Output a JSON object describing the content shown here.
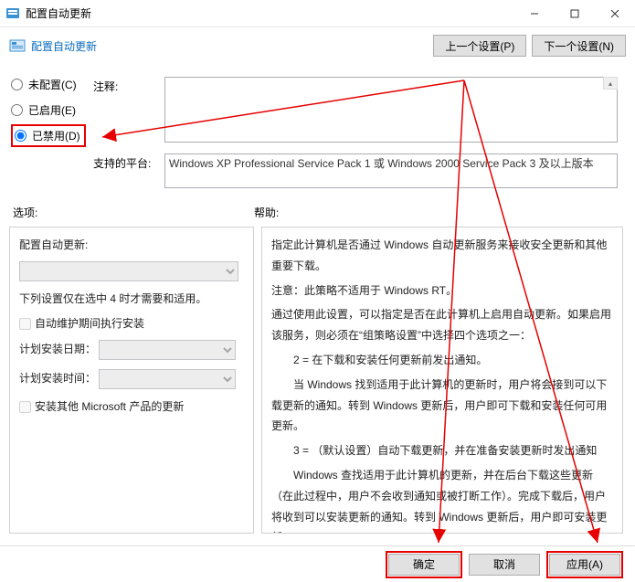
{
  "window": {
    "title": "配置自动更新"
  },
  "header": {
    "title": "配置自动更新",
    "prev_btn": "上一个设置(P)",
    "next_btn": "下一个设置(N)"
  },
  "radios": {
    "not_configured": "未配置(C)",
    "enabled": "已启用(E)",
    "disabled": "已禁用(D)"
  },
  "labels": {
    "comment": "注释:",
    "supported": "支持的平台:",
    "options": "选项:",
    "help": "帮助:"
  },
  "supported_text": "Windows XP Professional Service Pack 1 或 Windows 2000 Service Pack 3 及以上版本",
  "options": {
    "line1": "配置自动更新:",
    "note": "下列设置仅在选中 4 时才需要和适用。",
    "cb_maint": "自动维护期间执行安装",
    "sched_day": "计划安装日期：",
    "sched_time": "计划安装时间：",
    "cb_other": "安装其他 Microsoft 产品的更新"
  },
  "help": {
    "p1": "指定此计算机是否通过 Windows 自动更新服务来接收安全更新和其他重要下载。",
    "p2": "注意：此策略不适用于 Windows RT。",
    "p3": "通过使用此设置，可以指定是否在此计算机上启用自动更新。如果启用该服务，则必须在“组策略设置”中选择四个选项之一：",
    "p4": "2 = 在下载和安装任何更新前发出通知。",
    "p5": "当 Windows 找到适用于此计算机的更新时，用户将会接到可以下载更新的通知。转到 Windows 更新后，用户即可下载和安装任何可用更新。",
    "p6": "3 = （默认设置）自动下载更新，并在准备安装更新时发出通知",
    "p7": "Windows 查找适用于此计算机的更新，并在后台下载这些更新（在此过程中，用户不会收到通知或被打断工作）。完成下载后，用户将收到可以安装更新的通知。转到 Windows 更新后，用户即可安装更新。"
  },
  "footer": {
    "ok": "确定",
    "cancel": "取消",
    "apply": "应用(A)"
  }
}
